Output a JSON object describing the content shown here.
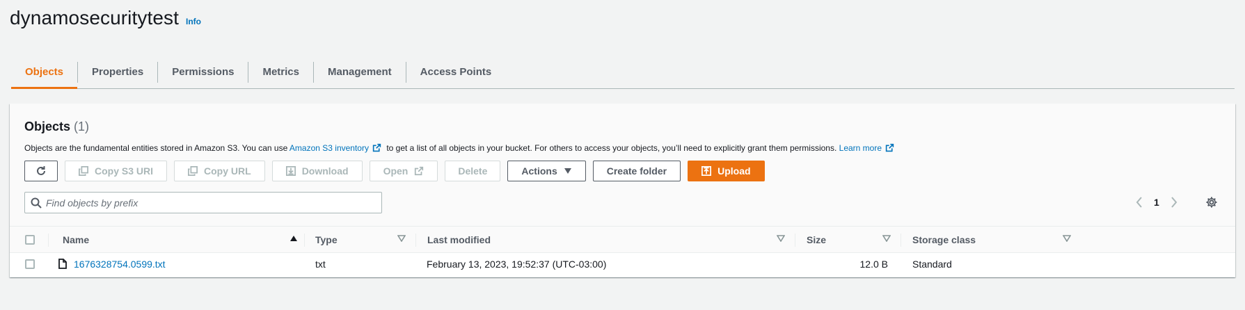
{
  "header": {
    "title": "dynamosecuritytest",
    "info_label": "Info"
  },
  "tabs": [
    {
      "label": "Objects",
      "active": true
    },
    {
      "label": "Properties",
      "active": false
    },
    {
      "label": "Permissions",
      "active": false
    },
    {
      "label": "Metrics",
      "active": false
    },
    {
      "label": "Management",
      "active": false
    },
    {
      "label": "Access Points",
      "active": false
    }
  ],
  "objects": {
    "heading": "Objects",
    "count": "(1)",
    "desc_part1": "Objects are the fundamental entities stored in Amazon S3. You can use",
    "inventory_link": "Amazon S3 inventory",
    "desc_part2": "to get a list of all objects in your bucket. For others to access your objects, you’ll need to explicitly grant them permissions.",
    "learn_more": "Learn more"
  },
  "toolbar": {
    "refresh_icon": "refresh-icon",
    "copy_s3_uri": "Copy S3 URI",
    "copy_url": "Copy URL",
    "download": "Download",
    "open": "Open",
    "delete": "Delete",
    "actions": "Actions",
    "create_folder": "Create folder",
    "upload": "Upload"
  },
  "search": {
    "placeholder": "Find objects by prefix",
    "value": ""
  },
  "pagination": {
    "current_page": "1"
  },
  "table": {
    "columns": {
      "name": "Name",
      "type": "Type",
      "last_modified": "Last modified",
      "size": "Size",
      "storage_class": "Storage class"
    },
    "rows": [
      {
        "name": "1676328754.0599.txt",
        "type": "txt",
        "last_modified": "February 13, 2023, 19:52:37 (UTC-03:00)",
        "size": "12.0 B",
        "storage_class": "Standard"
      }
    ]
  },
  "colors": {
    "accent": "#ec7211",
    "link": "#0073bb",
    "text": "#16191f",
    "muted": "#545b64",
    "disabled": "#aab7b8",
    "background": "#f2f3f3"
  }
}
